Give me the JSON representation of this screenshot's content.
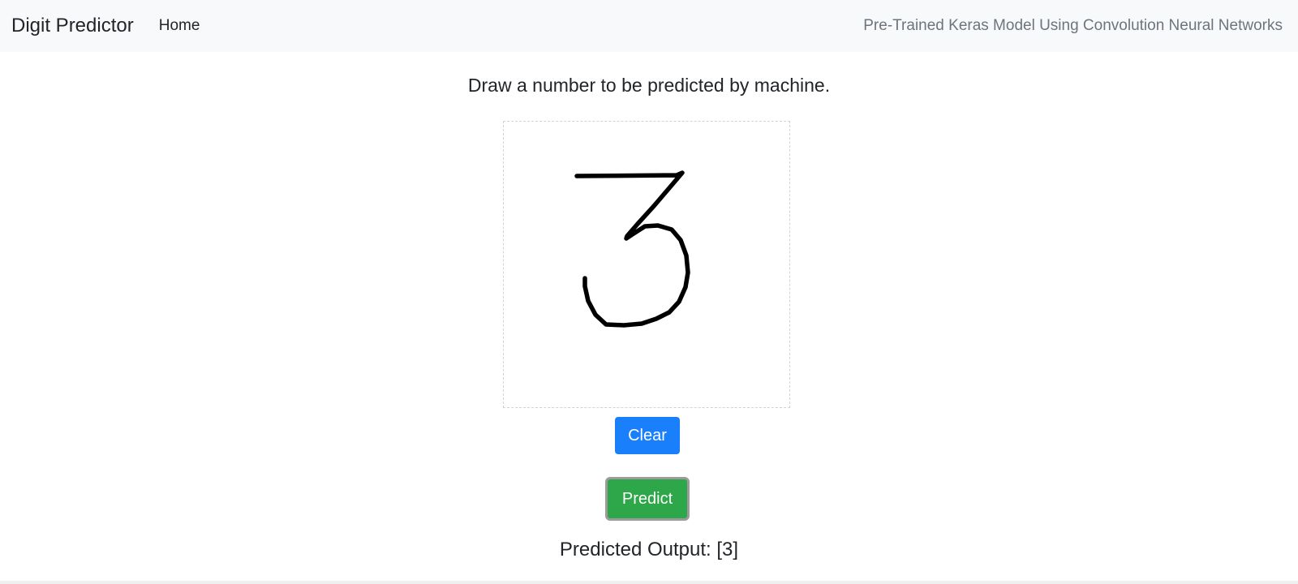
{
  "navbar": {
    "brand": "Digit Predictor",
    "home_link": "Home",
    "tagline": "Pre-Trained Keras Model Using Convolution Neural Networks"
  },
  "main": {
    "instruction": "Draw a number to be predicted by machine.",
    "clear_label": "Clear",
    "predict_label": "Predict",
    "output_label": "Predicted Output:",
    "output_value": "[3]"
  },
  "colors": {
    "navbar_bg": "#f8f9fa",
    "clear_button": "#1a7ffb",
    "predict_button": "#2ea74a",
    "stroke": "#000000"
  },
  "canvas": {
    "drawn_digit": "3"
  }
}
